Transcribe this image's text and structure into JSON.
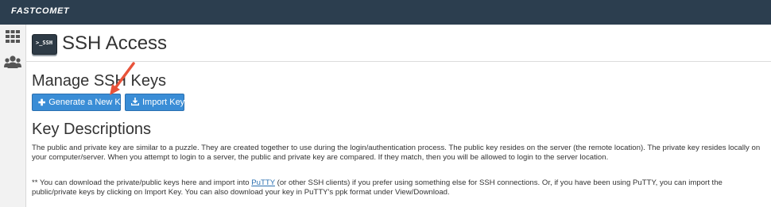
{
  "topbar": {
    "brand": "FASTCOMET"
  },
  "sidebar": {
    "items": [
      {
        "icon": "grid-icon"
      },
      {
        "icon": "users-icon"
      }
    ]
  },
  "header": {
    "icon_text": ">_SSH",
    "title": "SSH Access"
  },
  "manage": {
    "title": "Manage SSH Keys",
    "generate_label": "Generate a New Key",
    "import_label": "Import Key"
  },
  "descriptions": {
    "title": "Key Descriptions",
    "para1": "The public and private key are similar to a puzzle. They are created together to use during the login/authentication process. The public key resides on the server (the remote location). The private key resides locally on your computer/server. When you attempt to login to a server, the public and private key are compared. If they match, then you will be allowed to login to the server location.",
    "para2_before": "** You can download the private/public keys here and import into ",
    "para2_link": "PuTTY",
    "para2_after": " (or other SSH clients) if you prefer using something else for SSH connections. Or, if you have been using PuTTY, you can import the public/private keys by clicking on Import Key. You can also download your key in PuTTY's ppk format under View/Download."
  },
  "colors": {
    "topbar": "#2c3e4f",
    "button": "#3a8dd6",
    "arrow": "#e8533a",
    "link": "#2a6fb0"
  }
}
